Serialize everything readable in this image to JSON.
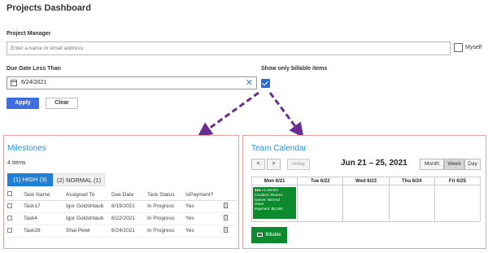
{
  "page": {
    "title": "Projects Dashboard"
  },
  "filters": {
    "pm_label": "Project Manager",
    "pm_placeholder": "Enter a name or email address",
    "myself_label": "Myself",
    "due_label": "Due Date Less Than",
    "due_value": "6/24/2021",
    "billable_label": "Show only billable items",
    "billable_checked": true,
    "apply": "Apply",
    "clear": "Clear"
  },
  "milestones": {
    "title": "Milestones",
    "count": "4 items",
    "tabs": [
      {
        "label": "(1) HIGH (3)",
        "active": true
      },
      {
        "label": "(2) NORMAL (1)",
        "active": false
      }
    ],
    "columns": [
      "Task Name",
      "Assigned To",
      "Due Date",
      "Task Status",
      "IsPayment?"
    ],
    "rows": [
      {
        "name": "Task17",
        "assigned": "Igor Goldshtaub",
        "due": "6/19/2021",
        "status": "In Progress",
        "payment": "Yes"
      },
      {
        "name": "Task4",
        "assigned": "Igor Goldshtaub",
        "due": "6/22/2021",
        "status": "In Progress",
        "payment": "Yes"
      },
      {
        "name": "Task28",
        "assigned": "Shai Petel",
        "due": "6/24/2021",
        "status": "In Progress",
        "payment": "Yes"
      }
    ]
  },
  "calendar": {
    "title": "Team Calendar",
    "prev": "<",
    "next": ">",
    "today": "today",
    "range": "Jun 21 – 25, 2021",
    "views": [
      "Month",
      "Week",
      "Day"
    ],
    "active_view": "Week",
    "days": [
      "Mon 6/21",
      "Tue 6/22",
      "Wed 6/23",
      "Thu 6/24",
      "Fri 6/25"
    ],
    "event": {
      "time_label": "12a",
      "name": "c1-event1",
      "location": "Location: Room1",
      "owner": "Owner: Nimrod",
      "owner2": "Geva",
      "payment": "Payment: $2,500",
      "color": "#0d8a2e"
    },
    "legend": "Billable"
  },
  "colors": {
    "accent": "#3f6de0",
    "link": "#2b8fd6",
    "arrow": "#6a2c91",
    "panel_border": "#e8a0a0",
    "event": "#0d8a2e"
  }
}
